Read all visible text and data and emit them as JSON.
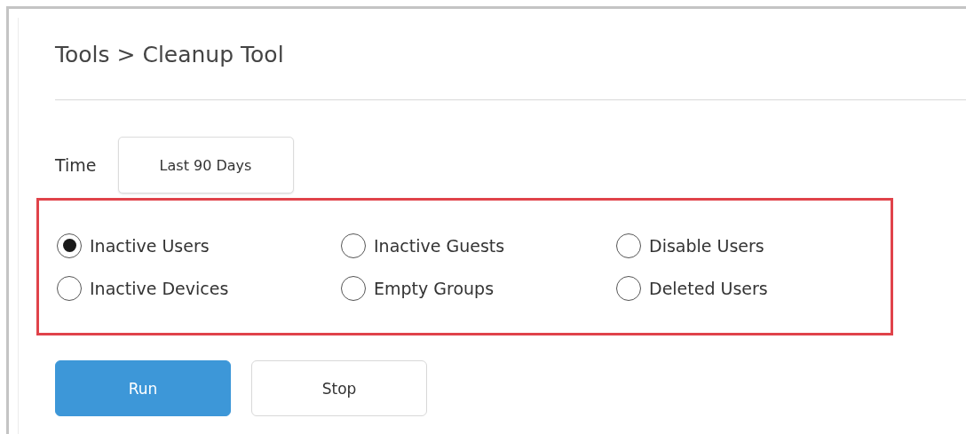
{
  "breadcrumb": "Tools > Cleanup Tool",
  "time": {
    "label": "Time",
    "value": "Last 90 Days"
  },
  "options": {
    "highlighted": true,
    "items": [
      {
        "label": "Inactive Users",
        "selected": true
      },
      {
        "label": "Inactive Guests",
        "selected": false
      },
      {
        "label": "Disable Users",
        "selected": false
      },
      {
        "label": "Inactive Devices",
        "selected": false
      },
      {
        "label": "Empty Groups",
        "selected": false
      },
      {
        "label": "Deleted Users",
        "selected": false
      }
    ]
  },
  "buttons": [
    {
      "label": "Run",
      "kind": "primary"
    },
    {
      "label": "Stop",
      "kind": "secondary"
    }
  ]
}
